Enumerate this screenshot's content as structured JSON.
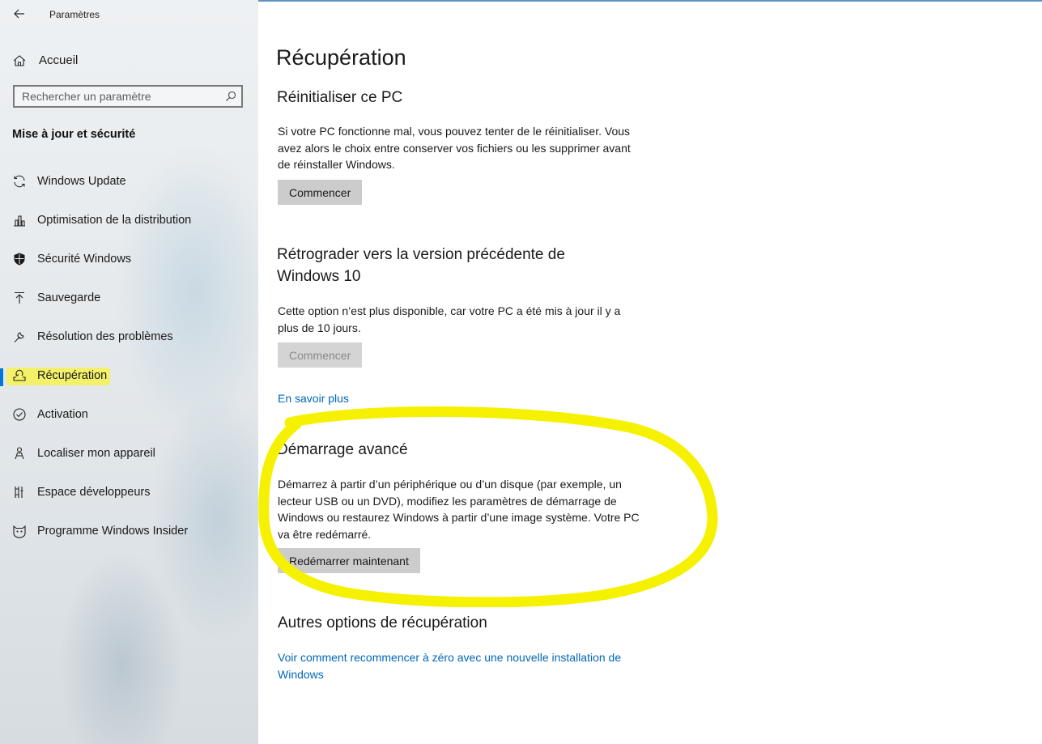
{
  "window": {
    "app_title": "Paramètres"
  },
  "sidebar": {
    "home_label": "Accueil",
    "search_placeholder": "Rechercher un paramètre",
    "section_title": "Mise à jour et sécurité",
    "items": [
      {
        "label": "Windows Update",
        "icon": "refresh-icon"
      },
      {
        "label": "Optimisation de la distribution",
        "icon": "delivery-optimization-icon"
      },
      {
        "label": "Sécurité Windows",
        "icon": "shield-icon"
      },
      {
        "label": "Sauvegarde",
        "icon": "upload-arrow-icon"
      },
      {
        "label": "Résolution des problèmes",
        "icon": "wrench-icon"
      },
      {
        "label": "Récupération",
        "icon": "recovery-icon",
        "active": true
      },
      {
        "label": "Activation",
        "icon": "check-circle-icon"
      },
      {
        "label": "Localiser mon appareil",
        "icon": "person-location-icon"
      },
      {
        "label": "Espace développeurs",
        "icon": "developer-icon"
      },
      {
        "label": "Programme Windows Insider",
        "icon": "insider-cat-icon"
      }
    ]
  },
  "main": {
    "page_title": "Récupération",
    "reset": {
      "heading": "Réinitialiser ce PC",
      "text": "Si votre PC fonctionne mal, vous pouvez tenter de le réinitialiser. Vous avez alors le choix entre conserver vos fichiers ou les supprimer avant de réinstaller Windows.",
      "button": "Commencer"
    },
    "rollback": {
      "heading": "Rétrograder vers la version précédente de Windows 10",
      "text": "Cette option n’est plus disponible, car votre PC a été mis à jour il y a plus de 10 jours.",
      "button": "Commencer",
      "link": "En savoir plus"
    },
    "advanced": {
      "heading": "Démarrage avancé",
      "text": "Démarrez à partir d’un périphérique ou d’un disque (par exemple, un lecteur USB ou un DVD), modifiez les paramètres de démarrage de Windows ou restaurez Windows à partir d’une image système. Votre PC va être redémarré.",
      "button": "Redémarrer maintenant"
    },
    "other": {
      "heading": "Autres options de récupération",
      "link": "Voir comment recommencer à zéro avec une nouvelle installation de Windows"
    }
  },
  "colors": {
    "accent": "#0078d4",
    "link": "#0067b8",
    "highlight": "#f5f100",
    "button_bg": "#cccccc"
  }
}
